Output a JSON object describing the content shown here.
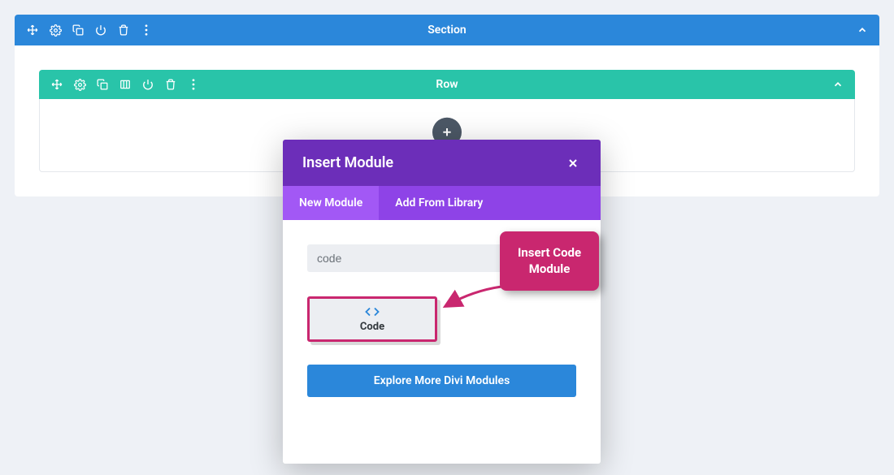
{
  "section": {
    "title": "Section",
    "icons": [
      "move-icon",
      "gear-icon",
      "duplicate-icon",
      "power-icon",
      "trash-icon",
      "more-icon"
    ]
  },
  "row": {
    "title": "Row",
    "icons": [
      "move-icon",
      "gear-icon",
      "duplicate-icon",
      "columns-icon",
      "power-icon",
      "trash-icon",
      "more-icon"
    ]
  },
  "modal": {
    "title": "Insert Module",
    "tabs": {
      "new": "New Module",
      "library": "Add From Library"
    },
    "search_value": "code",
    "module": {
      "label": "Code"
    },
    "explore_label": "Explore More Divi Modules"
  },
  "callout": {
    "line1": "Insert Code",
    "line2": "Module"
  }
}
